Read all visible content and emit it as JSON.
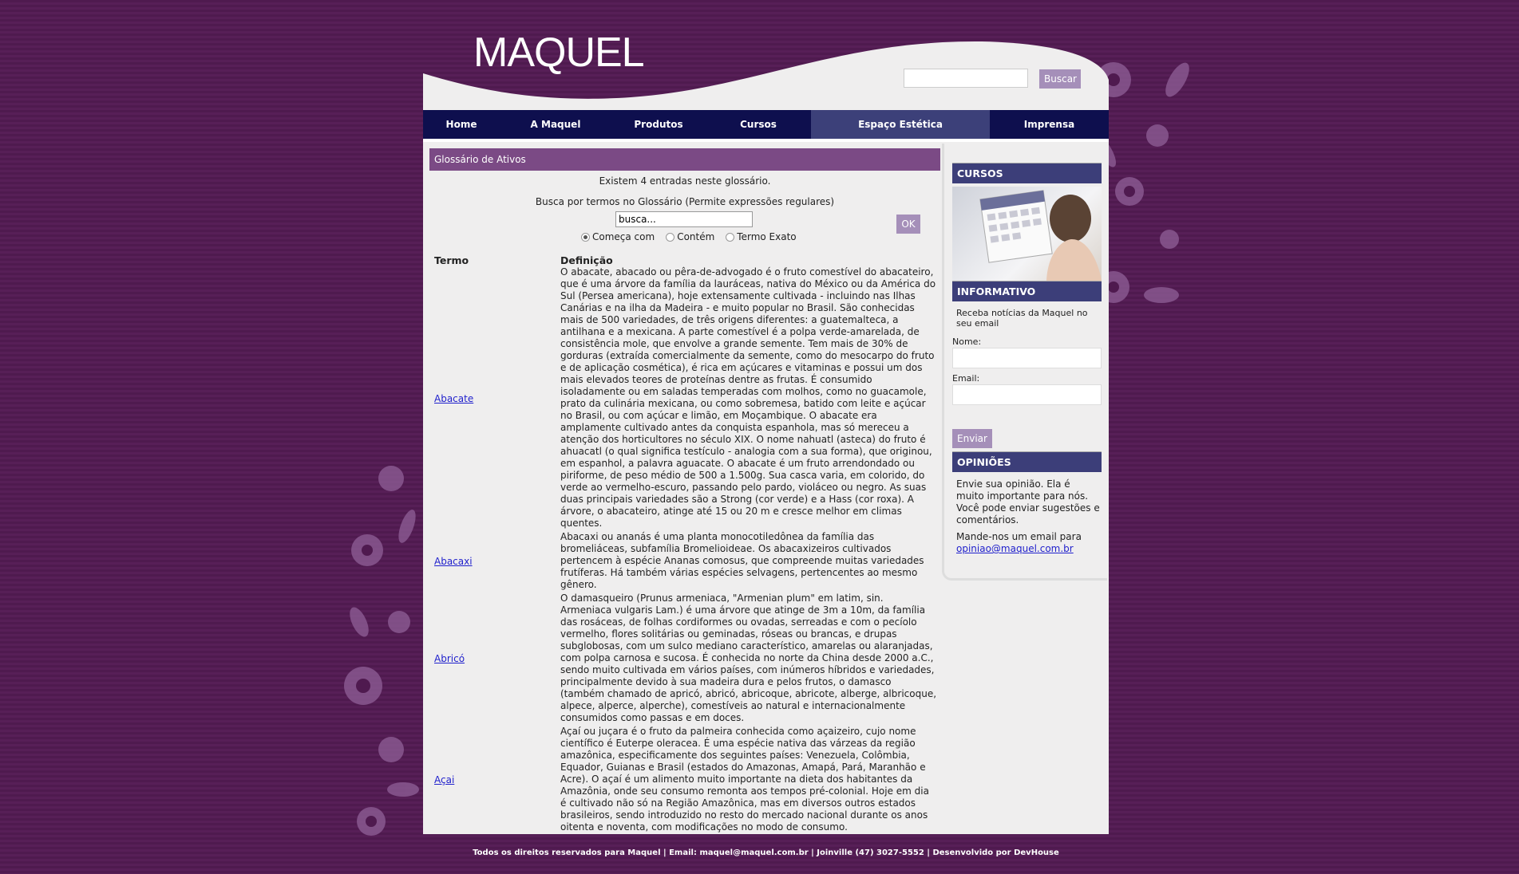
{
  "header": {
    "logo_text": "MAQUEL",
    "search_button": "Buscar",
    "search_value": ""
  },
  "nav": {
    "items": [
      {
        "label": "Home"
      },
      {
        "label": "A Maquel"
      },
      {
        "label": "Produtos"
      },
      {
        "label": "Cursos"
      },
      {
        "label": "Espaço Estética",
        "active": true
      },
      {
        "label": "Imprensa"
      }
    ]
  },
  "glossary": {
    "title": "Glossário de Ativos",
    "entries_count": "Existem 4 entradas neste glossário.",
    "search_hint": "Busca por termos no Glossário (Permite expressões regulares)",
    "search_value": "busca...",
    "ok_button": "OK",
    "radio_options": [
      "Começa com",
      "Contém",
      "Termo Exato"
    ],
    "selected_radio": "Começa com",
    "column_term": "Termo",
    "column_definition": "Definição",
    "rows": [
      {
        "term": "Abacate",
        "definition": "O abacate, abacado ou pêra-de-advogado é o fruto comestível do abacateiro, que é uma árvore da família da lauráceas, nativa do México ou da América do Sul (Persea americana), hoje extensamente cultivada - incluindo nas Ilhas Canárias e na ilha da Madeira - e muito popular no Brasil. São conhecidas mais de 500 variedades, de três origens diferentes: a guatemalteca, a antilhana e a mexicana. A parte comestível é a polpa verde-amarelada, de consistência mole, que envolve a grande semente. Tem mais de 30% de gorduras (extraída comercialmente da semente, como do mesocarpo do fruto e de aplicação cosmética), é rica em açúcares e vitaminas e possui um dos mais elevados teores de proteínas dentre as frutas. É consumido isoladamente ou em saladas temperadas com molhos, como no guacamole, prato da culinária mexicana, ou como sobremesa, batido com leite e açúcar no Brasil, ou com açúcar e limão, em Moçambique. O abacate era amplamente cultivado antes da conquista espanhola, mas só mereceu a atenção dos horticultores no século XIX. O nome nahuatl (asteca) do fruto é ahuacatl (o qual significa testículo - analogia com a sua forma), que originou, em espanhol, a palavra aguacate. O abacate é um fruto arrendondado ou piriforme, de peso médio de 500 a 1.500g. Sua casca varia, em colorido, do verde ao vermelho-escuro, passando pelo pardo, violáceo ou negro. As suas duas principais variedades são a Strong (cor verde) e a Hass (cor roxa). A árvore, o abacateiro, atinge até 15 ou 20 m e cresce melhor em climas quentes."
      },
      {
        "term": "Abacaxi",
        "definition": "Abacaxi ou ananás é uma planta monocotiledônea da família das bromeliáceas, subfamília Bromelioideae. Os abacaxizeiros cultivados pertencem à espécie Ananas comosus, que compreende muitas variedades frutíferas. Há também várias espécies selvagens, pertencentes ao mesmo gênero."
      },
      {
        "term": "Abricó",
        "definition": "O damasqueiro (Prunus armeniaca, \"Armenian plum\" em latim, sin. Armeniaca vulgaris Lam.) é uma árvore que atinge de 3m a 10m, da família das rosáceas, de folhas cordiformes ou ovadas, serreadas e com o pecíolo vermelho, flores solitárias ou geminadas, róseas ou brancas, e drupas subglobosas, com um sulco mediano característico, amarelas ou alaranjadas, com polpa carnosa e sucosa. É conhecida no norte da China desde 2000 a.C., sendo muito cultivada em vários países, com inúmeros híbridos e variedades, principalmente devido à sua madeira dura e pelos frutos, o damasco (também chamado de apricó, abricó, abricoque, abricote, alberge, albricoque, alpece, alperce, alperche), comestíveis ao natural e internacionalmente consumidos como passas e em doces."
      },
      {
        "term": "Açai",
        "definition": "Açaí ou juçara é o fruto da palmeira conhecida como açaizeiro, cujo nome científico é Euterpe oleracea. É uma espécie nativa das várzeas da região amazônica, especificamente dos seguintes países: Venezuela, Colômbia, Equador, Guianas e Brasil (estados do Amazonas, Amapá, Pará, Maranhão e Acre). O açaí é um alimento muito importante na dieta dos habitantes da Amazônia, onde seu consumo remonta aos tempos pré-colonial. Hoje em dia é cultivado não só na Região Amazônica, mas em diversos outros estados brasileiros, sendo introduzido no resto do mercado nacional durante os anos oitenta e noventa, com modificações no modo de consumo."
      }
    ]
  },
  "sidebar": {
    "cursos_title": "CURSOS",
    "informativo_title": "INFORMATIVO",
    "informativo_text": "Receba notícias da Maquel no seu email",
    "name_label": "Nome:",
    "email_label": "Email:",
    "send_button": "Enviar",
    "opinioes_title": "OPINIÕES",
    "opinioes_text": "Envie sua opinião. Ela é muito importante para nós. Você pode enviar sugestões e comentários.",
    "opinioes_contact": "Mande-nos um email para",
    "opinioes_email": "opiniao@maquel.com.br"
  },
  "footer": {
    "text": "Todos os direitos reservados para Maquel | Email: maquel@maquel.com.br | Joinville (47) 3027-5552 | Desenvolvido por DevHouse"
  },
  "colors": {
    "background": "#4f1a4f",
    "nav": "#0e0f4e",
    "nav_active": "#3c4079",
    "section_title": "#7b4a85",
    "button": "#a58fb9"
  }
}
